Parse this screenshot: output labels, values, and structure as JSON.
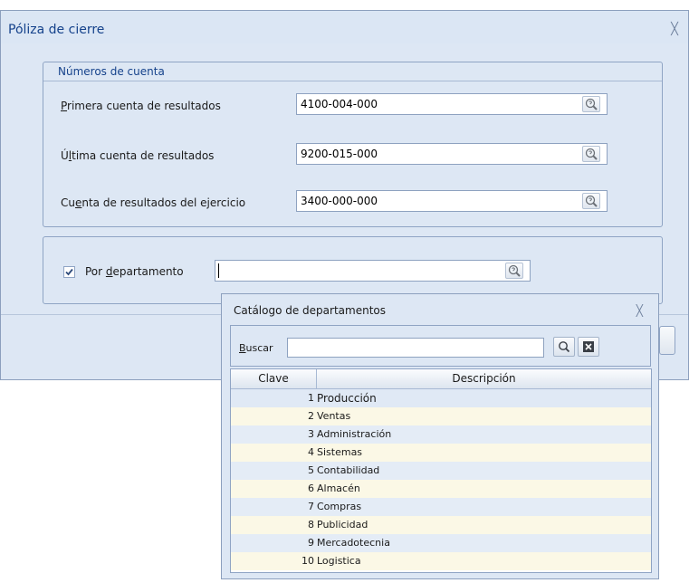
{
  "dialog": {
    "title": "Póliza de cierre",
    "close_glyph": "╳",
    "accounts_group": {
      "header": "Números de cuenta",
      "rows": [
        {
          "label": "Primera cuenta de resultados",
          "value": "4100-004-000"
        },
        {
          "label": "Última cuenta de resultados",
          "value": "9200-015-000"
        },
        {
          "label": "Cuenta de resultados del ejercicio",
          "value": "3400-000-000"
        }
      ]
    },
    "department": {
      "checkbox_checked": true,
      "label": "Por departamento",
      "value": ""
    }
  },
  "catalog": {
    "title": "Catálogo de departamentos",
    "close_glyph": "╳",
    "search_label": "Buscar",
    "search_value": "",
    "columns": [
      "Clave",
      "Descripción"
    ],
    "rows": [
      {
        "key": "1",
        "desc": "Producción"
      },
      {
        "key": "2",
        "desc": "Ventas"
      },
      {
        "key": "3",
        "desc": "Administración"
      },
      {
        "key": "4",
        "desc": "Sistemas"
      },
      {
        "key": "5",
        "desc": "Contabilidad"
      },
      {
        "key": "6",
        "desc": "Almacén"
      },
      {
        "key": "7",
        "desc": "Compras"
      },
      {
        "key": "8",
        "desc": "Publicidad"
      },
      {
        "key": "9",
        "desc": "Mercadotecnia"
      },
      {
        "key": "10",
        "desc": "Logistica"
      }
    ]
  },
  "colors": {
    "title_text": "#15428b",
    "dialog_background": "#dde7f4",
    "row_odd": "#e4ecf6",
    "row_even": "#fbf8e6"
  }
}
